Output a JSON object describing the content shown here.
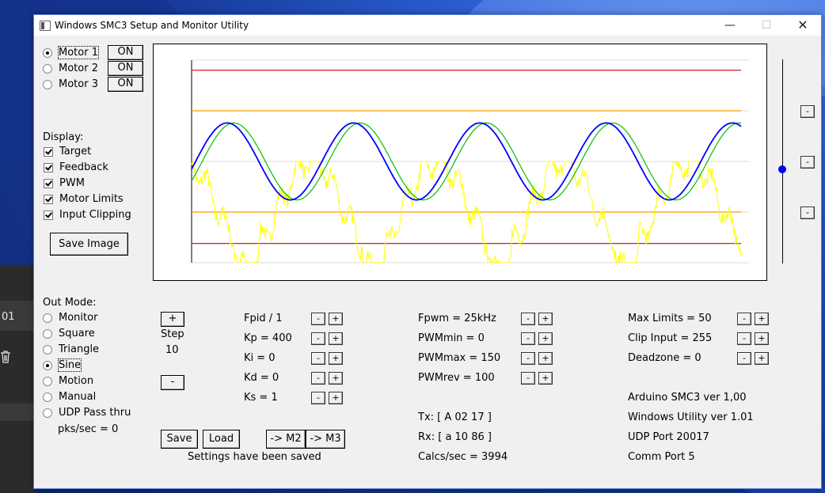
{
  "window": {
    "title": "Windows SMC3 Setup and Monitor Utility",
    "minimize_label": "—",
    "maximize_label": "☐",
    "close_label": "✕"
  },
  "background": {
    "partial_text": "01"
  },
  "motors": [
    {
      "label": "Motor 1",
      "selected": true,
      "button": "ON"
    },
    {
      "label": "Motor 2",
      "selected": false,
      "button": "ON"
    },
    {
      "label": "Motor 3",
      "selected": false,
      "button": "ON"
    }
  ],
  "display": {
    "heading": "Display:",
    "options": [
      {
        "label": "Target",
        "checked": true
      },
      {
        "label": "Feedback",
        "checked": true
      },
      {
        "label": "PWM",
        "checked": true
      },
      {
        "label": "Motor Limits",
        "checked": true
      },
      {
        "label": "Input Clipping",
        "checked": true
      }
    ]
  },
  "save_image_label": "Save Image",
  "out_mode": {
    "heading": "Out Mode:",
    "options": [
      {
        "label": "Monitor",
        "selected": false
      },
      {
        "label": "Square",
        "selected": false
      },
      {
        "label": "Triangle",
        "selected": false
      },
      {
        "label": "Sine",
        "selected": true
      },
      {
        "label": "Motion",
        "selected": false
      },
      {
        "label": "Manual",
        "selected": false
      },
      {
        "label": "UDP Pass thru",
        "selected": false
      }
    ],
    "pks_label": "pks/sec = 0"
  },
  "step": {
    "plus_label": "+",
    "label": "Step",
    "value": "10",
    "minus_label": "-"
  },
  "pid_params": [
    "Fpid / 1",
    "Kp = 400",
    "Ki = 0",
    "Kd = 0",
    "Ks = 1"
  ],
  "pwm_params": [
    "Fpwm = 25kHz",
    "PWMmin = 0",
    "PWMmax = 150",
    "PWMrev = 100"
  ],
  "limit_params": [
    "Max Limits = 50",
    "Clip Input = 255",
    "Deadzone = 0"
  ],
  "adjust": {
    "minus": "-",
    "plus": "+"
  },
  "status": {
    "tx": "Tx: [ A 02 17 ]",
    "rx": "Rx: [ a 10 86 ]",
    "calcs": "Calcs/sec = 3994"
  },
  "info": [
    "Arduino SMC3 ver 1,00",
    "Windows Utility ver 1.01",
    "UDP Port 20017",
    "Comm Port 5"
  ],
  "actions": {
    "save": "Save",
    "load": "Load",
    "to_m2": "-> M2",
    "to_m3": "-> M3"
  },
  "settings_status": "Settings have been saved",
  "slider": {
    "level": 0.54,
    "buttons": [
      "-",
      "-",
      "-"
    ]
  },
  "chart_data": {
    "type": "line",
    "x": [
      0,
      1
    ],
    "ylim": [
      0,
      1
    ],
    "grid": true,
    "colors": {
      "target": "#0000ff",
      "feedback": "#00c000",
      "pwm": "#ffff00",
      "motor_limits": "#d00000",
      "input_clipping": "#ff9900"
    },
    "series": [
      {
        "key": "target",
        "cycles": 4.35,
        "mean": 0.5,
        "amplitude": 0.19,
        "phase": 0.0
      },
      {
        "key": "feedback",
        "cycles": 4.35,
        "mean": 0.5,
        "amplitude": 0.19,
        "phase": 0.012
      }
    ],
    "motor_limits": [
      0.095,
      0.95
    ],
    "input_clipping": [
      0.25,
      0.75
    ],
    "pwm_level_range": [
      0.0,
      0.5
    ]
  }
}
